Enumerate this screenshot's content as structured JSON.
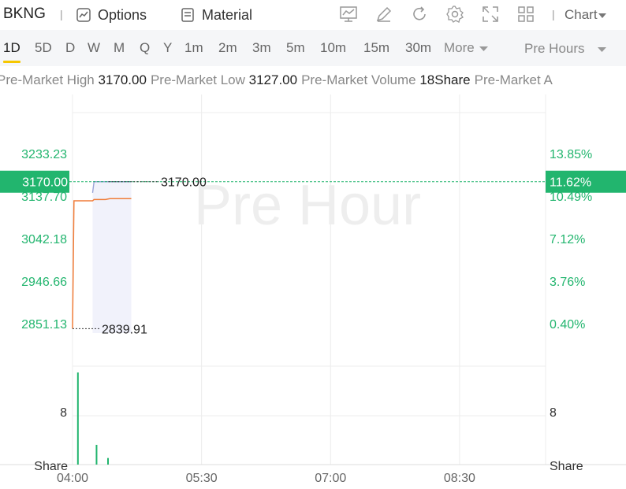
{
  "toolbar": {
    "symbol": "BKNG",
    "separator": "|",
    "options_label": "Options",
    "material_label": "Material",
    "chart_label": "Chart",
    "icons": [
      "line-chart-icon",
      "pen-icon",
      "refresh-icon",
      "gear-icon",
      "expand-icon",
      "grid-icon"
    ]
  },
  "periods": {
    "items": [
      "1D",
      "5D",
      "D",
      "W",
      "M",
      "Q",
      "Y",
      "1m",
      "2m",
      "3m",
      "5m",
      "10m",
      "15m",
      "30m"
    ],
    "active": "1D",
    "more_label": "More",
    "session_label": "Pre Hours"
  },
  "stats": [
    {
      "label": "Pre-Market High",
      "value": "3170.00"
    },
    {
      "label": "Pre-Market Low",
      "value": "3127.00"
    },
    {
      "label": "Pre-Market Volume",
      "value": "18Share"
    },
    {
      "label": "Pre-Market A",
      "value": ""
    }
  ],
  "colors": {
    "price_line": "#f07c38",
    "avg_line": "#9aa4d8",
    "area_fill": "#f1f2fb",
    "axis_green": "#22b56e",
    "current_tag_bg": "#22b56e",
    "volume_bar": "#22b56e",
    "grid": "#ececec"
  },
  "chart_data": {
    "type": "line",
    "watermark": "Pre Hour",
    "price_axis": {
      "ticks": [
        "3233.23",
        "3137.70",
        "3042.18",
        "2946.66",
        "2851.13"
      ],
      "tick_values": [
        3233.23,
        3137.7,
        3042.18,
        2946.66,
        2851.13
      ],
      "percent_ticks": [
        "13.85%",
        "10.49%",
        "7.12%",
        "3.76%",
        "0.40%"
      ]
    },
    "x_axis": {
      "ticks": [
        "04:00",
        "05:30",
        "07:00",
        "08:30"
      ],
      "range": [
        "04:00",
        "09:30"
      ]
    },
    "current": {
      "price": "3170.00",
      "percent": "11.62%",
      "value": 3170.0
    },
    "annotations": [
      {
        "label": "3170.00",
        "value": 3170.0,
        "x": "04:25"
      },
      {
        "label": "2839.91",
        "value": 2839.91,
        "x": "04:00"
      }
    ],
    "series": [
      {
        "name": "",
        "x": [
          "04:00",
          "04:01",
          "04:02",
          "04:14",
          "04:15",
          "04:23",
          "04:26",
          "04:41"
        ],
        "values": [
          2839.91,
          3127.0,
          3127.0,
          3127.0,
          3130.0,
          3130.0,
          3132.0,
          3132.0
        ]
      },
      {
        "name": "",
        "x": [
          "04:14",
          "04:15",
          "04:41"
        ],
        "values": [
          3145.0,
          3170.0,
          3170.0
        ]
      }
    ],
    "volume": {
      "unit_label": "Share",
      "ticks": [
        "8"
      ],
      "tick_values": [
        8
      ],
      "ylim": [
        0,
        14
      ],
      "x": [
        "04:01",
        "04:14",
        "04:22"
      ],
      "values": [
        14,
        3,
        1
      ]
    }
  }
}
